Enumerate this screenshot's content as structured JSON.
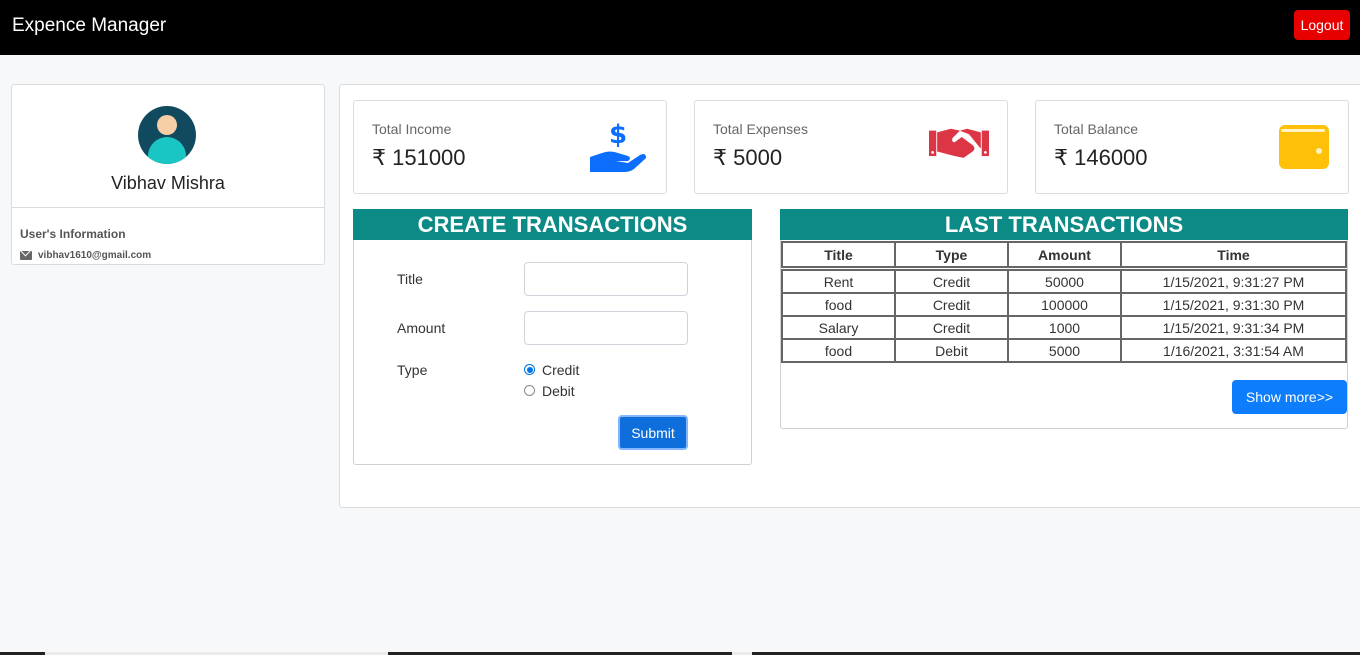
{
  "app": {
    "title": "Expence Manager",
    "logout_label": "Logout"
  },
  "profile": {
    "name": "Vibhav Mishra",
    "info_title": "User's Information",
    "email": "vibhav1610@gmail.com"
  },
  "stats": {
    "income": {
      "label": "Total Income",
      "value": "₹ 151000",
      "icon": "hand-dollar-icon",
      "color": "#0d6efd"
    },
    "expenses": {
      "label": "Total Expenses",
      "value": "₹ 5000",
      "icon": "handshake-icon",
      "color": "#dc3545"
    },
    "balance": {
      "label": "Total Balance",
      "value": "₹ 146000",
      "icon": "wallet-icon",
      "color": "#ffc107"
    }
  },
  "create": {
    "heading": "CREATE TRANSACTIONS",
    "title_label": "Title",
    "title_value": "",
    "amount_label": "Amount",
    "amount_value": "",
    "type_label": "Type",
    "type_options": [
      "Credit",
      "Debit"
    ],
    "selected_type": "Credit",
    "submit_label": "Submit"
  },
  "last": {
    "heading": "LAST TRANSACTIONS",
    "columns": [
      "Title",
      "Type",
      "Amount",
      "Time"
    ],
    "rows": [
      [
        "Rent",
        "Credit",
        "50000",
        "1/15/2021, 9:31:27 PM"
      ],
      [
        "food",
        "Credit",
        "100000",
        "1/15/2021, 9:31:30 PM"
      ],
      [
        "Salary",
        "Credit",
        "1000",
        "1/15/2021, 9:31:34 PM"
      ],
      [
        "food",
        "Debit",
        "5000",
        "1/16/2021, 3:31:54 AM"
      ]
    ],
    "show_more_label": "Show more>>"
  },
  "colors": {
    "navbar": "#000000",
    "accent": "#0c8b86",
    "logout": "#e60000",
    "primary": "#0d6edc"
  }
}
